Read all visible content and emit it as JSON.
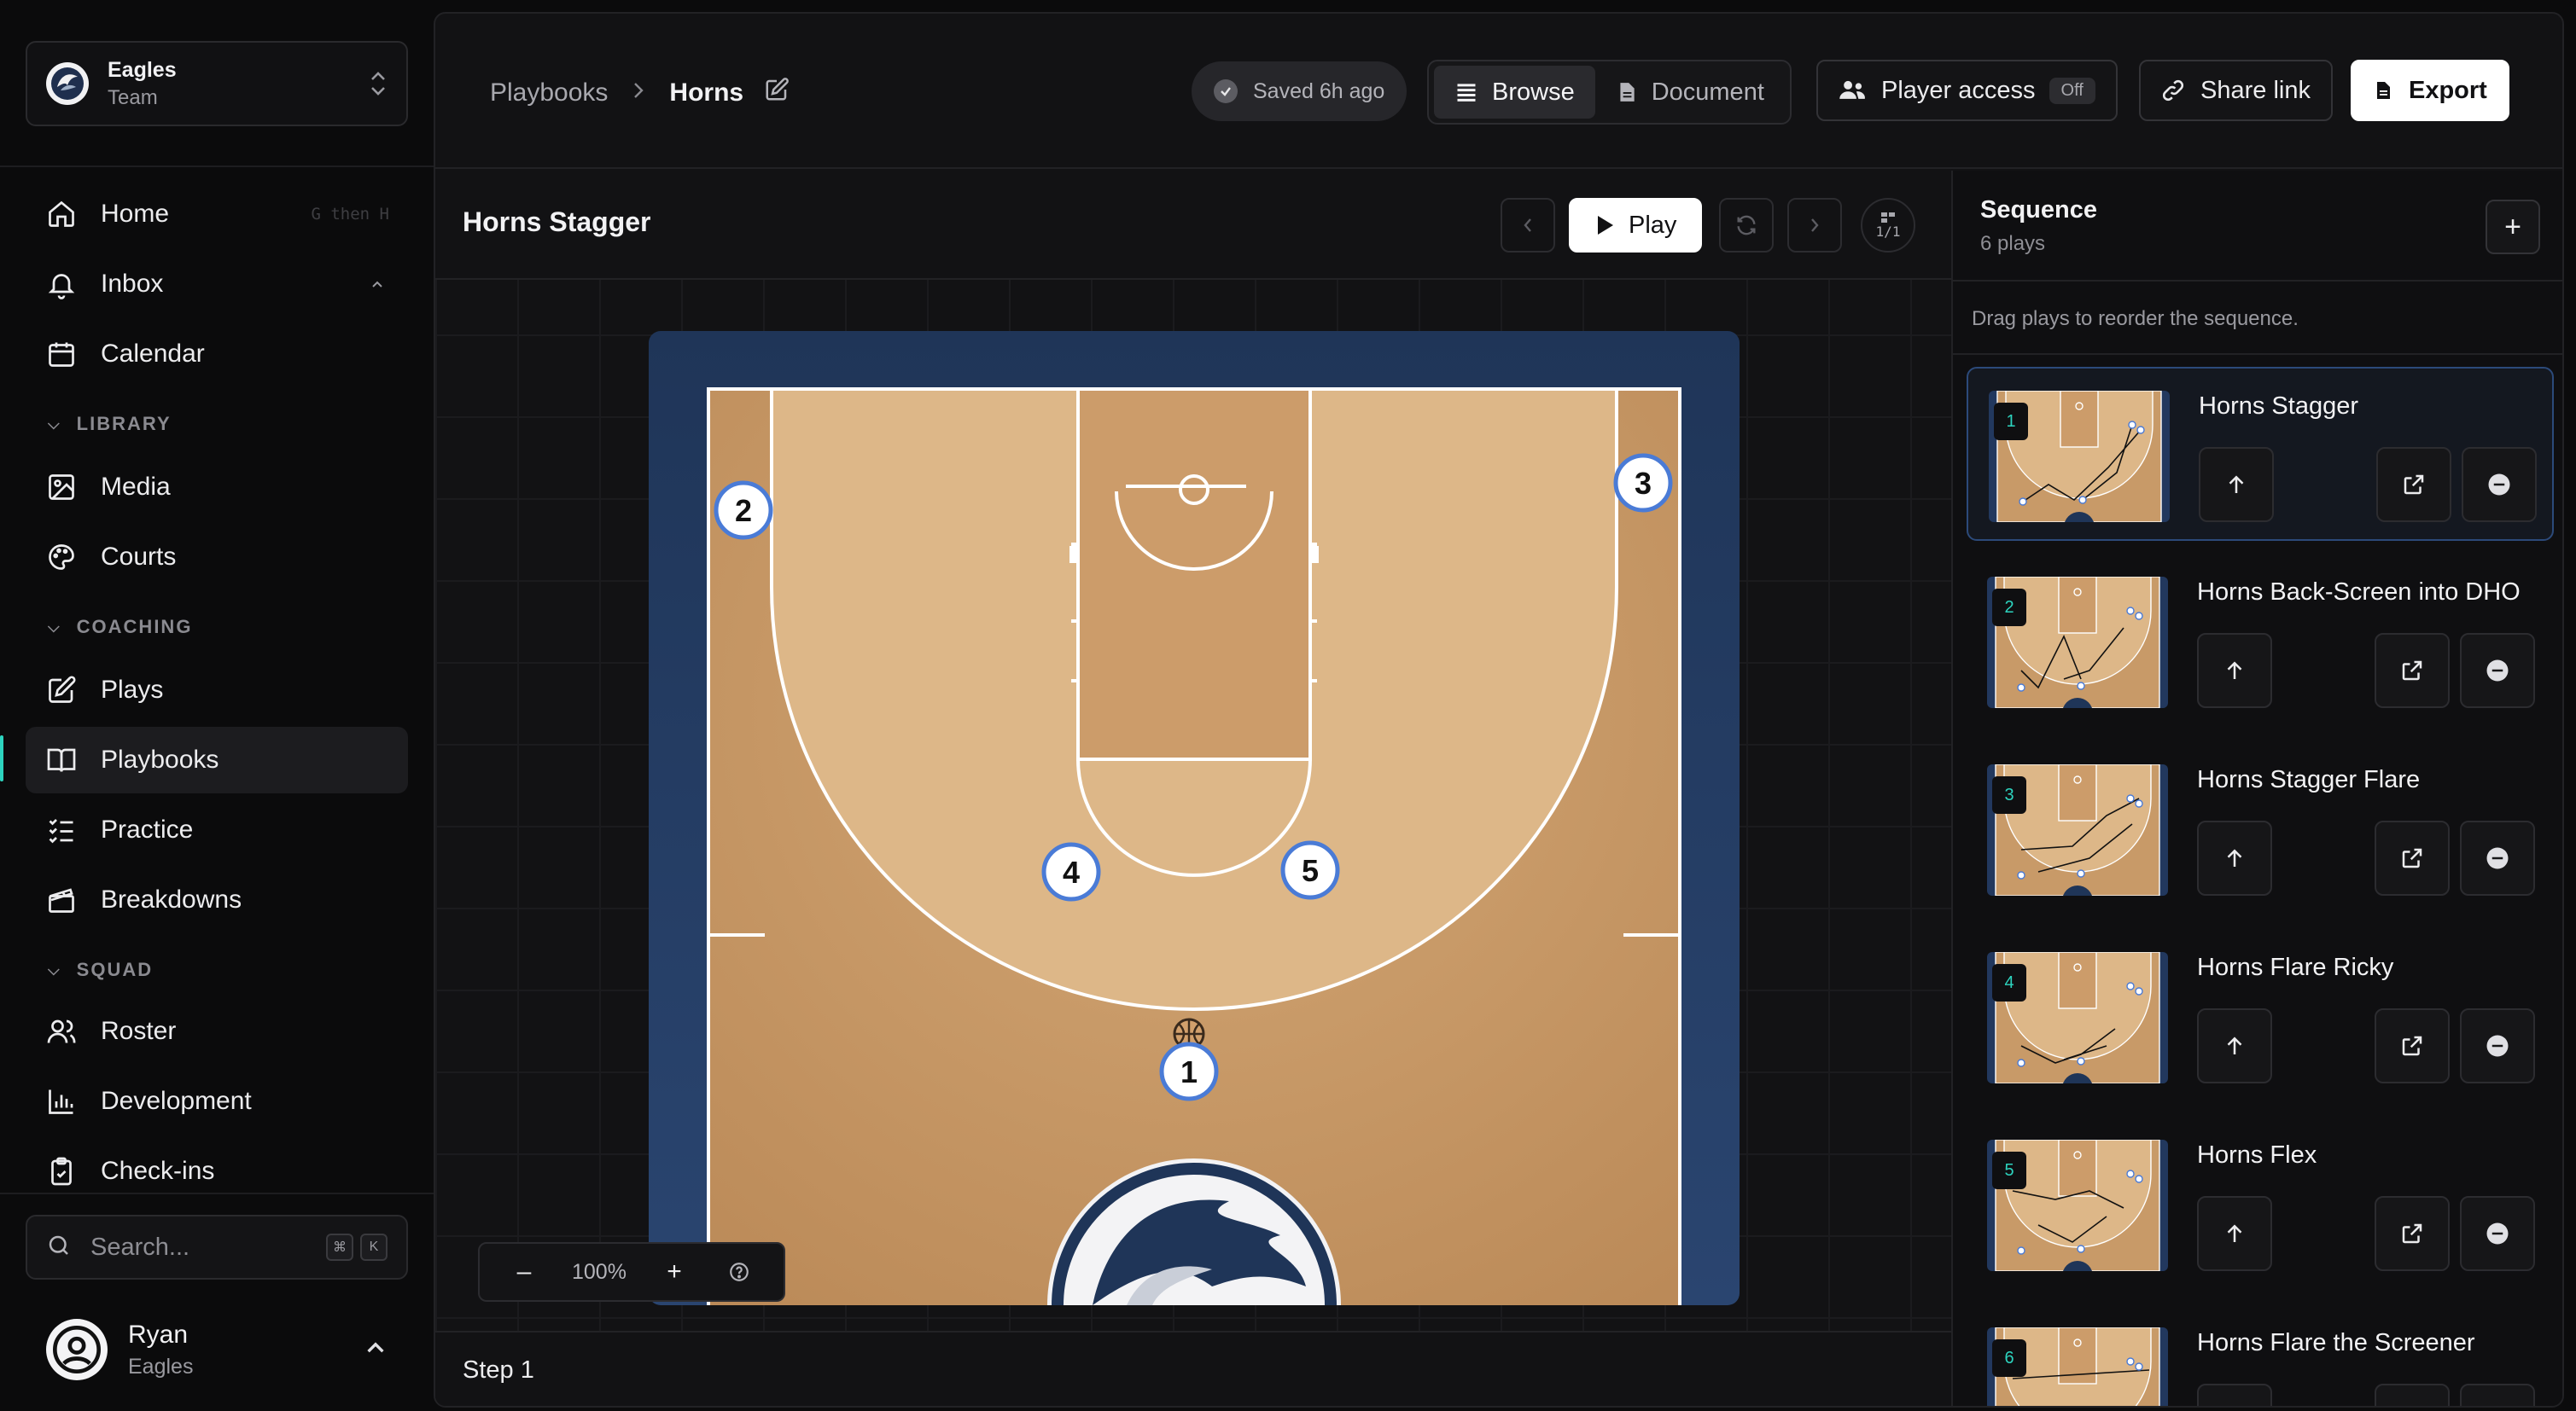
{
  "sidebar": {
    "team": {
      "name": "Eagles",
      "sub": "Team"
    },
    "nav_top": [
      {
        "label": "Home",
        "hint": "G then H",
        "icon": "home-icon"
      },
      {
        "label": "Inbox",
        "icon": "bell-icon"
      },
      {
        "label": "Calendar",
        "icon": "calendar-icon"
      }
    ],
    "sections": {
      "library": "LIBRARY",
      "coaching": "COACHING",
      "squad": "SQUAD"
    },
    "library_items": [
      {
        "label": "Media",
        "icon": "image-icon"
      },
      {
        "label": "Courts",
        "icon": "palette-icon"
      }
    ],
    "coaching_items": [
      {
        "label": "Plays",
        "icon": "edit-icon"
      },
      {
        "label": "Playbooks",
        "icon": "book-icon",
        "active": true
      },
      {
        "label": "Practice",
        "icon": "checklist-icon"
      },
      {
        "label": "Breakdowns",
        "icon": "clapperboard-icon"
      }
    ],
    "squad_items": [
      {
        "label": "Roster",
        "icon": "users-icon"
      },
      {
        "label": "Development",
        "icon": "bar-chart-icon"
      },
      {
        "label": "Check-ins",
        "icon": "clipboard-check-icon"
      }
    ],
    "search": {
      "placeholder": "Search...",
      "kbd1": "⌘",
      "kbd2": "K"
    },
    "user": {
      "name": "Ryan",
      "team": "Eagles"
    }
  },
  "topbar": {
    "breadcrumb_root": "Playbooks",
    "breadcrumb_current": "Horns",
    "saved": "Saved 6h ago",
    "view_browse": "Browse",
    "view_document": "Document",
    "player_access": "Player access",
    "player_access_state": "Off",
    "share_link": "Share link",
    "export": "Export"
  },
  "editor": {
    "play_title": "Horns Stagger",
    "play_button": "Play",
    "counter": "1/1",
    "zoom": "100%",
    "step": "Step 1",
    "players": [
      "1",
      "2",
      "3",
      "4",
      "5"
    ]
  },
  "sequence": {
    "title": "Sequence",
    "count": "6 plays",
    "hint": "Drag plays to reorder the sequence.",
    "plays": [
      {
        "num": "1",
        "title": "Horns Stagger"
      },
      {
        "num": "2",
        "title": "Horns Back-Screen into DHO"
      },
      {
        "num": "3",
        "title": "Horns Stagger Flare"
      },
      {
        "num": "4",
        "title": "Horns Flare Ricky"
      },
      {
        "num": "5",
        "title": "Horns Flex"
      },
      {
        "num": "6",
        "title": "Horns Flare the Screener"
      }
    ]
  },
  "colors": {
    "accent": "#2dd4bf",
    "court_wood": "#c89a68",
    "court_paint": "#d9b383",
    "court_border": "#22385e",
    "selected_card_border": "#2c4a7a"
  }
}
